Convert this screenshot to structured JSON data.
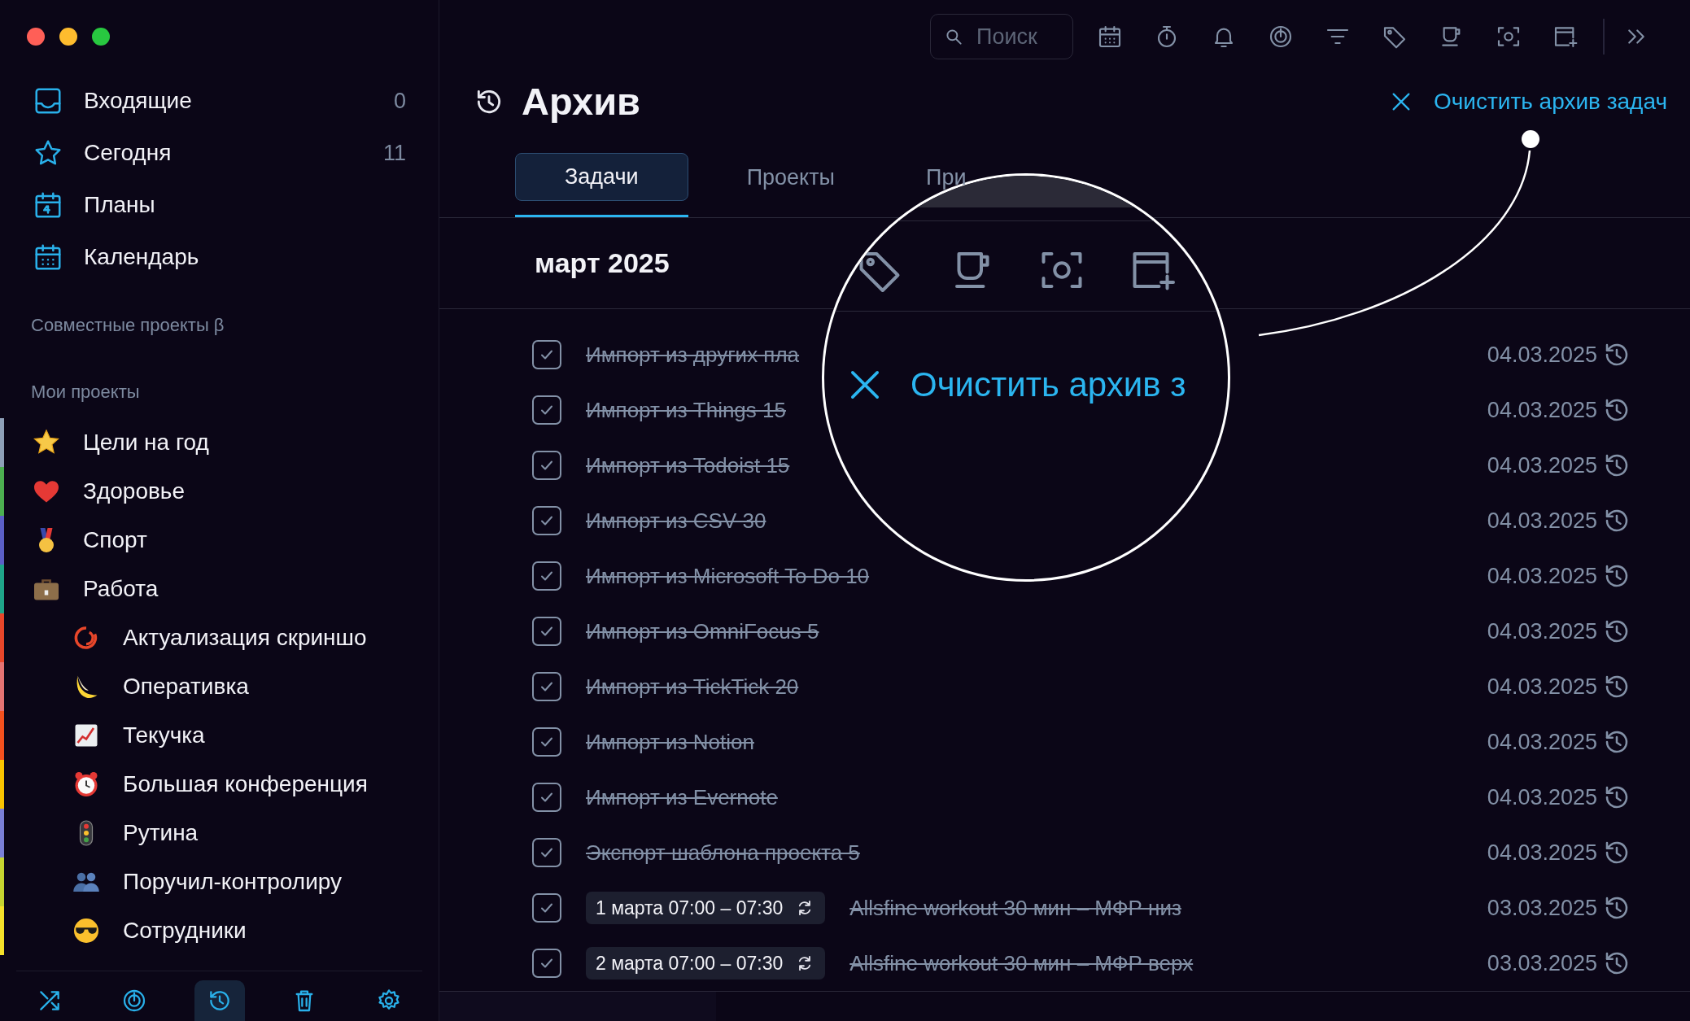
{
  "window": {
    "controls": [
      {
        "color": "#ff5f57"
      },
      {
        "color": "#febc2e"
      },
      {
        "color": "#28c840"
      }
    ]
  },
  "sidebar": {
    "nav": [
      {
        "label": "Входящие",
        "count": "0"
      },
      {
        "label": "Сегодня",
        "count": "11"
      },
      {
        "label": "Планы"
      },
      {
        "label": "Календарь"
      }
    ],
    "shared_heading": "Совместные проекты β",
    "projects_heading": "Мои проекты",
    "projects": [
      {
        "label": "Цели на год",
        "color": "#8ea0b8"
      },
      {
        "label": "Здоровье",
        "color": "#4caf50"
      },
      {
        "label": "Спорт",
        "color": "#5b5fc7"
      },
      {
        "label": "Работа",
        "color": "#1fa58a",
        "children": [
          {
            "label": "Актуализация скриншо",
            "color": "#e8462a"
          },
          {
            "label": "Оперативка",
            "color": "#e57373"
          },
          {
            "label": "Текучка",
            "color": "#f4511e"
          },
          {
            "label": "Большая конференция",
            "color": "#f9c300"
          },
          {
            "label": "Рутина",
            "color": "#7a7fd6"
          },
          {
            "label": "Поручил-контролиру",
            "color": "#c6d430"
          },
          {
            "label": "Сотрудники",
            "color": "#f5e12a"
          }
        ]
      }
    ],
    "bottom_toolbar": [
      {
        "selected": false
      },
      {
        "selected": false
      },
      {
        "selected": true
      },
      {
        "selected": false
      },
      {
        "selected": false
      }
    ]
  },
  "toolbar": {
    "search": {
      "placeholder": "Поиск"
    }
  },
  "header": {
    "title": "Архив",
    "clear_action": "Очистить архив задач"
  },
  "tabs": [
    {
      "label": "Задачи",
      "selected": true
    },
    {
      "label": "Проекты",
      "selected": false
    },
    {
      "label": "При",
      "selected": false
    }
  ],
  "month": "март 2025",
  "tasks": [
    {
      "title": "Импорт из других пла",
      "date": "04.03.2025",
      "checked": true
    },
    {
      "title": "Импорт из Things 15",
      "date": "04.03.2025",
      "checked": true
    },
    {
      "title": "Импорт из Todoist 15",
      "date": "04.03.2025",
      "checked": true
    },
    {
      "title": "Импорт из CSV 30",
      "date": "04.03.2025",
      "checked": true
    },
    {
      "title": "Импорт из Microsoft To Do 10",
      "date": "04.03.2025",
      "checked": true
    },
    {
      "title": "Импорт из OmniFocus 5",
      "date": "04.03.2025",
      "checked": true
    },
    {
      "title": "Импорт из TickTick 20",
      "date": "04.03.2025",
      "checked": true
    },
    {
      "title": "Импорт из Notion",
      "date": "04.03.2025",
      "checked": true
    },
    {
      "title": "Импорт из Evernote",
      "date": "04.03.2025",
      "checked": true
    },
    {
      "title": "Экспорт шаблона проекта 5",
      "date": "04.03.2025",
      "checked": true
    },
    {
      "time": "1 марта 07:00 – 07:30",
      "title": "Allsfine workout 30 мин – МФР низ",
      "date": "03.03.2025",
      "checked": true
    },
    {
      "time": "2 марта 07:00 – 07:30",
      "title": "Allsfine workout 30 мин – МФР верх",
      "date": "03.03.2025",
      "checked": true
    }
  ],
  "magnifier": {
    "action": "Очистить архив з"
  }
}
